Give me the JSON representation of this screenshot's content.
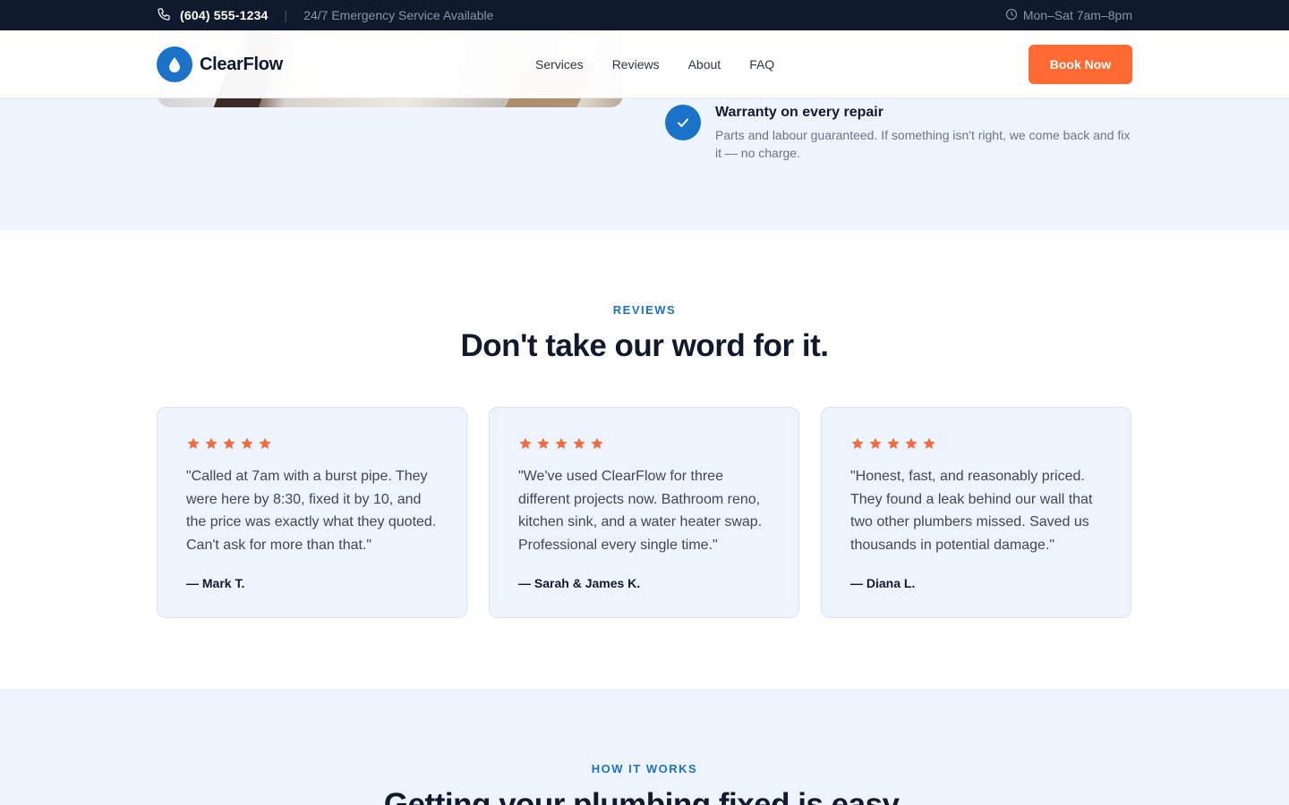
{
  "topbar": {
    "phone": "(604) 555-1234",
    "separator": "|",
    "emergency": "24/7 Emergency Service Available",
    "hours": "Mon–Sat 7am–8pm",
    "phone_icon": "phone-icon",
    "clock_icon": "clock-icon"
  },
  "header": {
    "brand": "ClearFlow",
    "logo_icon": "water-drop-icon",
    "nav": [
      "Services",
      "Reviews",
      "About",
      "FAQ"
    ],
    "cta": "Book Now"
  },
  "hero": {
    "feature": {
      "title": "Warranty on every repair",
      "desc": "Parts and labour guaranteed. If something isn't right, we come back and fix it — no charge."
    }
  },
  "reviews": {
    "eyebrow": "REVIEWS",
    "title": "Don't take our word for it.",
    "items": [
      {
        "stars": 5,
        "quote": "\"Called at 7am with a burst pipe. They were here by 8:30, fixed it by 10, and the price was exactly what they quoted. Can't ask for more than that.\"",
        "author": "— Mark T."
      },
      {
        "stars": 5,
        "quote": "\"We've used ClearFlow for three different projects now. Bathroom reno, kitchen sink, and a water heater swap. Professional every single time.\"",
        "author": "— Sarah & James K."
      },
      {
        "stars": 5,
        "quote": "\"Honest, fast, and reasonably priced. They found a leak behind our wall that two other plumbers missed. Saved us thousands in potential damage.\"",
        "author": "— Diana L."
      }
    ]
  },
  "how": {
    "eyebrow": "HOW IT WORKS",
    "title": "Getting your plumbing fixed is easy."
  },
  "colors": {
    "navy": "#0f1b2d",
    "brand_blue": "#1a73c9",
    "accent_orange": "#ff6a33",
    "light_blue_bg": "#eef4fd",
    "star_orange": "#f26a3d"
  }
}
